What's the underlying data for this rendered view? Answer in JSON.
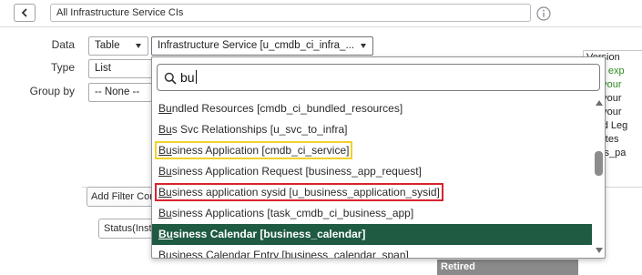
{
  "header": {
    "report_title": "All Infrastructure Service CIs"
  },
  "form": {
    "data_label": "Data",
    "data_source_value": "Table",
    "table_value": "Infrastructure Service [u_cmdb_ci_infra_...",
    "type_label": "Type",
    "type_value": "List",
    "group_by_label": "Group by",
    "group_by_value": "-- None --"
  },
  "right_column": {
    "header": "Version",
    "rows": [
      "anty exp",
      "t is your",
      "t is your",
      "t is your",
      "n did Leg",
      "k notes",
      "class_pa"
    ]
  },
  "filter": {
    "add_filter_label": "Add Filter Cor",
    "status_label": "Status(Insta",
    "retired_value": "Retired"
  },
  "dropdown": {
    "search_value": "bu",
    "match_prefix_length": 2,
    "results": [
      {
        "label": "Bundled Resources [cmdb_ci_bundled_resources]",
        "state": "normal"
      },
      {
        "label": "Bus Svc Relationships [u_svc_to_infra]",
        "state": "normal"
      },
      {
        "label": "Business Application [cmdb_ci_service]",
        "state": "outlined-yellow"
      },
      {
        "label": "Business Application Request [business_app_request]",
        "state": "normal"
      },
      {
        "label": "Business application sysid [u_business_application_sysid]",
        "state": "outlined-red"
      },
      {
        "label": "Business Applications [task_cmdb_ci_business_app]",
        "state": "normal"
      },
      {
        "label": "Business Calendar [business_calendar]",
        "state": "highlighted"
      },
      {
        "label": "Business Calendar Entry [business_calendar_span]",
        "state": "normal"
      }
    ]
  },
  "colors": {
    "highlight_bg": "#1f5a43",
    "yellow_outline": "#f0d22a",
    "red_outline": "#d9232e",
    "green_text": "#2e8b1f"
  }
}
